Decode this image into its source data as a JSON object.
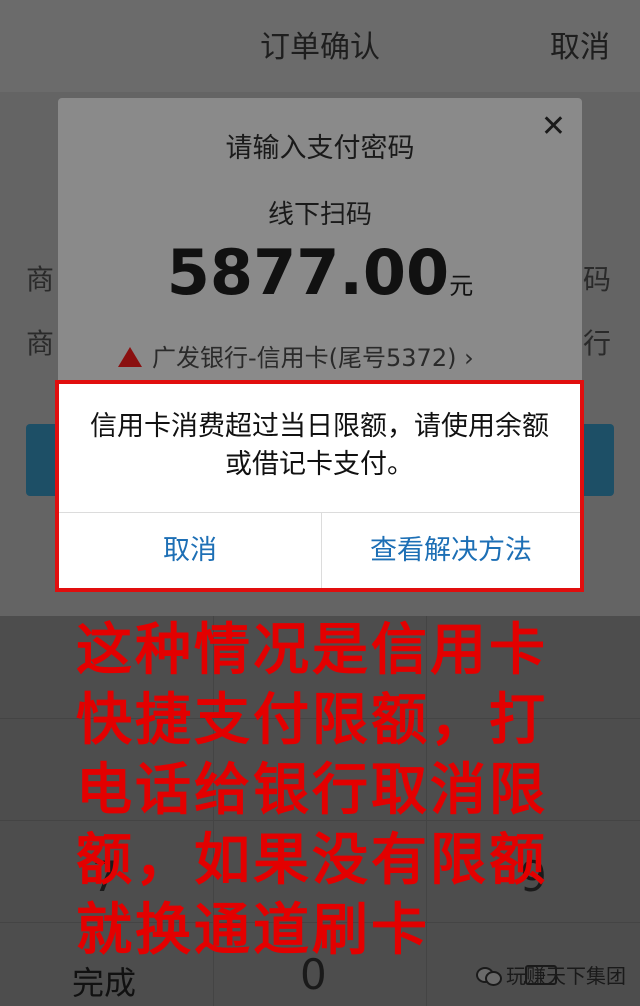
{
  "header": {
    "title": "订单确认",
    "cancel_label": "取消"
  },
  "under_page": {
    "row1_left": "商",
    "row1_right": "码",
    "row2_left": "商",
    "row2_right": "行"
  },
  "pay_dialog": {
    "title": "请输入支付密码",
    "close_icon": "close-icon",
    "subtitle": "线下扫码",
    "amount": "5877.00",
    "currency": "元",
    "card": "广发银行-信用卡(尾号5372)",
    "card_chevron": "›"
  },
  "alert": {
    "message": "信用卡消费超过当日限额，请使用余额或借记卡支付。",
    "cancel_label": "取消",
    "solution_label": "查看解决方法",
    "frame_color": "#e10e0e"
  },
  "annotation": {
    "lines": [
      "这种情况是信用卡",
      "快捷支付限额，打",
      "电话给银行取消限",
      "额，如果没有限额",
      "就换通道刷卡"
    ],
    "color": "#e30000"
  },
  "keyboard": {
    "done_label": "完成",
    "zero_label": "0",
    "key_9": "9",
    "key_7": "7"
  },
  "watermark": {
    "text": "玩赚天下集团"
  }
}
